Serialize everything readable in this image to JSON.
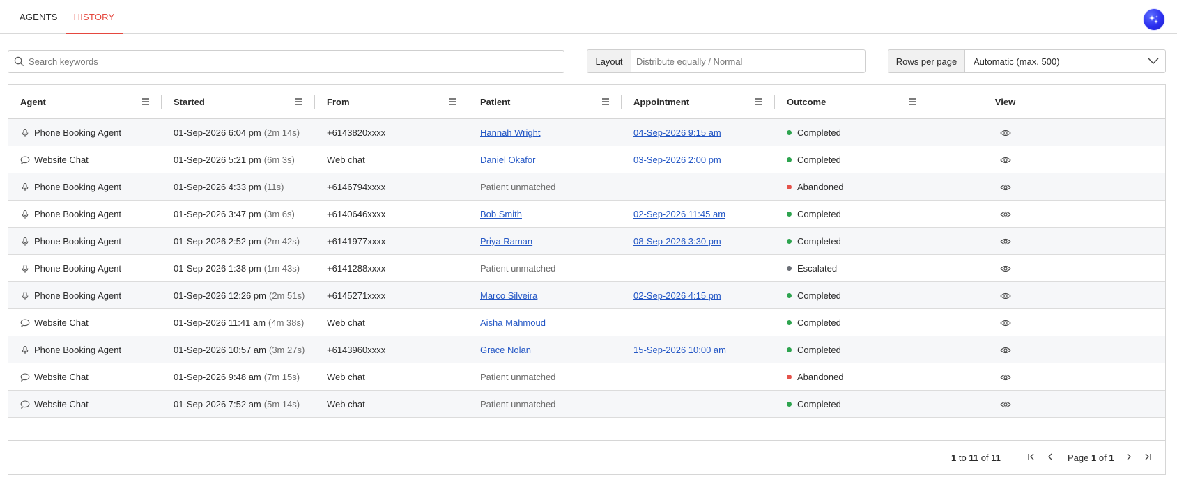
{
  "tabs": [
    {
      "label": "AGENTS",
      "active": false
    },
    {
      "label": "HISTORY",
      "active": true
    }
  ],
  "colors": {
    "accent": "#e5483f",
    "link": "#2457c5",
    "completed": "#2ea44f",
    "abandoned": "#e5534b",
    "escalated": "#6b6f76",
    "avatar": "#2c2ff0"
  },
  "search": {
    "placeholder": "Search keywords",
    "value": ""
  },
  "layout": {
    "label": "Layout",
    "value": "Distribute equally / Normal"
  },
  "rows_per_page": {
    "label": "Rows per page",
    "value": "Automatic (max. 500)"
  },
  "columns": [
    "Agent",
    "Started",
    "From",
    "Patient",
    "Appointment",
    "Outcome",
    "View"
  ],
  "rows": [
    {
      "agent": "Phone Booking Agent",
      "agent_icon": "microphone-icon",
      "started": "01-Sep-2026 6:04 pm",
      "duration": "(2m 14s)",
      "from": "+6143820xxxx",
      "patient": "Hannah Wright",
      "patient_matched": true,
      "appointment": "04-Sep-2026 9:15 am",
      "outcome": "Completed"
    },
    {
      "agent": "Website Chat",
      "agent_icon": "chat-bubble-icon",
      "started": "01-Sep-2026 5:21 pm",
      "duration": "(6m 3s)",
      "from": "Web chat",
      "patient": "Daniel Okafor",
      "patient_matched": true,
      "appointment": "03-Sep-2026 2:00 pm",
      "outcome": "Completed"
    },
    {
      "agent": "Phone Booking Agent",
      "agent_icon": "microphone-icon",
      "started": "01-Sep-2026 4:33 pm",
      "duration": "(11s)",
      "from": "+6146794xxxx",
      "patient": "Patient unmatched",
      "patient_matched": false,
      "appointment": "",
      "outcome": "Abandoned"
    },
    {
      "agent": "Phone Booking Agent",
      "agent_icon": "microphone-icon",
      "started": "01-Sep-2026 3:47 pm",
      "duration": "(3m 6s)",
      "from": "+6140646xxxx",
      "patient": "Bob Smith",
      "patient_matched": true,
      "appointment": "02-Sep-2026 11:45 am",
      "outcome": "Completed"
    },
    {
      "agent": "Phone Booking Agent",
      "agent_icon": "microphone-icon",
      "started": "01-Sep-2026 2:52 pm",
      "duration": "(2m 42s)",
      "from": "+6141977xxxx",
      "patient": "Priya Raman",
      "patient_matched": true,
      "appointment": "08-Sep-2026 3:30 pm",
      "outcome": "Completed"
    },
    {
      "agent": "Phone Booking Agent",
      "agent_icon": "microphone-icon",
      "started": "01-Sep-2026 1:38 pm",
      "duration": "(1m 43s)",
      "from": "+6141288xxxx",
      "patient": "Patient unmatched",
      "patient_matched": false,
      "appointment": "",
      "outcome": "Escalated"
    },
    {
      "agent": "Phone Booking Agent",
      "agent_icon": "microphone-icon",
      "started": "01-Sep-2026 12:26 pm",
      "duration": "(2m 51s)",
      "from": "+6145271xxxx",
      "patient": "Marco Silveira",
      "patient_matched": true,
      "appointment": "02-Sep-2026 4:15 pm",
      "outcome": "Completed"
    },
    {
      "agent": "Website Chat",
      "agent_icon": "chat-bubble-icon",
      "started": "01-Sep-2026 11:41 am",
      "duration": "(4m 38s)",
      "from": "Web chat",
      "patient": "Aisha Mahmoud",
      "patient_matched": true,
      "appointment": "",
      "outcome": "Completed"
    },
    {
      "agent": "Phone Booking Agent",
      "agent_icon": "microphone-icon",
      "started": "01-Sep-2026 10:57 am",
      "duration": "(3m 27s)",
      "from": "+6143960xxxx",
      "patient": "Grace Nolan",
      "patient_matched": true,
      "appointment": "15-Sep-2026 10:00 am",
      "outcome": "Completed"
    },
    {
      "agent": "Website Chat",
      "agent_icon": "chat-bubble-icon",
      "started": "01-Sep-2026 9:48 am",
      "duration": "(7m 15s)",
      "from": "Web chat",
      "patient": "Patient unmatched",
      "patient_matched": false,
      "appointment": "",
      "outcome": "Abandoned"
    },
    {
      "agent": "Website Chat",
      "agent_icon": "chat-bubble-icon",
      "started": "01-Sep-2026 7:52 am",
      "duration": "(5m 14s)",
      "from": "Web chat",
      "patient": "Patient unmatched",
      "patient_matched": false,
      "appointment": "",
      "outcome": "Completed"
    }
  ],
  "pagination": {
    "from": "1",
    "to_word": "to",
    "to": "11",
    "of_word": "of",
    "total": "11",
    "page_word": "Page",
    "page": "1",
    "pages": "1"
  }
}
